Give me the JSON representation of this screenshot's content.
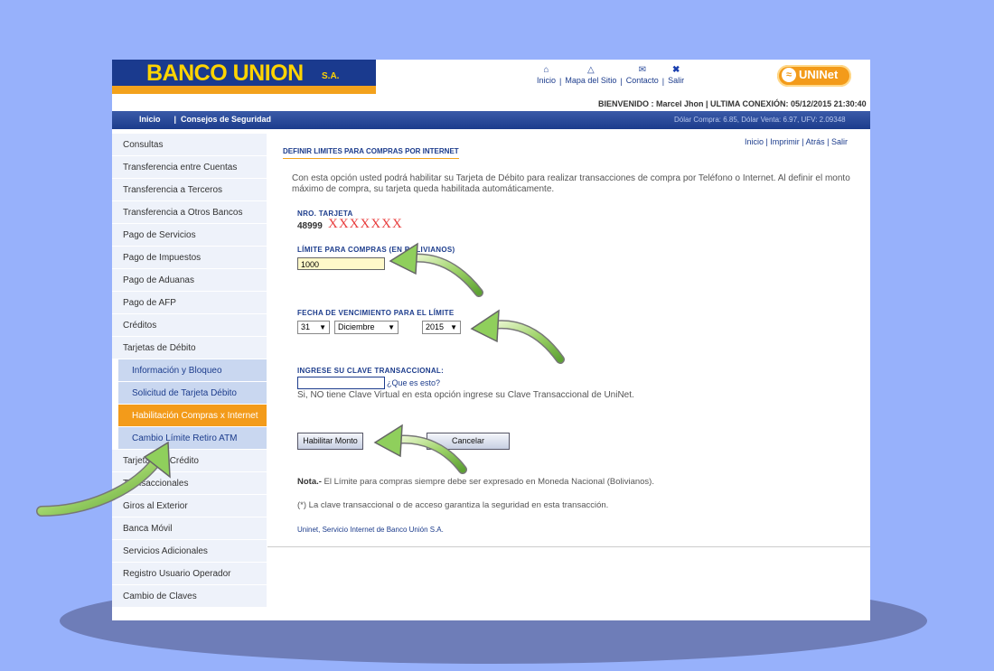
{
  "header": {
    "logo_text": "BANCO UNION",
    "logo_suffix": "S.A.",
    "nav": [
      {
        "label": "Inicio",
        "icon": "home-icon"
      },
      {
        "label": "Mapa del Sitio",
        "icon": "sitemap-icon"
      },
      {
        "label": "Contacto",
        "icon": "mail-icon"
      },
      {
        "label": "Salir",
        "icon": "close-icon"
      }
    ],
    "separator": "|",
    "uninet_logo": "UNINet",
    "welcome": "BIENVENIDO : Marcel Jhon | ULTIMA CONEXIÓN: 05/12/2015 21:30:40"
  },
  "navbar": {
    "links_text": "Inicio      |  Consejos de Seguridad",
    "rates": "Dólar Compra: 6.85, Dólar Venta: 6.97, UFV: 2.09348"
  },
  "sidebar": {
    "items_top": [
      "Consultas",
      "Transferencia entre Cuentas",
      "Transferencia a Terceros",
      "Transferencia a Otros Bancos",
      "Pago de Servicios",
      "Pago de Impuestos",
      "Pago de Aduanas",
      "Pago de AFP",
      "Créditos",
      "Tarjetas de Débito"
    ],
    "sub_items": [
      "Información y Bloqueo",
      "Solicitud de Tarjeta Débito",
      "Habilitación Compras x Internet",
      "Cambio Límite Retiro ATM"
    ],
    "items_bottom": [
      "Tarjetas de Crédito",
      "Transaccionales",
      "Giros al Exterior",
      "Banca Móvil",
      "Servicios Adicionales",
      "Registro Usuario Operador",
      "Cambio de Claves"
    ]
  },
  "content": {
    "util_links": "Inicio | Imprimir | Atrás | Salir",
    "title": "DEFINIR LIMITES PARA COMPRAS POR INTERNET",
    "description": "Con esta opción usted podrá habilitar su Tarjeta de Débito para realizar transacciones de compra por Teléfono o Internet. Al definir el monto máximo de compra, su tarjeta queda habilitada automáticamente.",
    "card_label": "NRO. TARJETA",
    "card_prefix": "48999",
    "card_mask": "XXXXXXX",
    "limit_label": "LÍMITE PARA COMPRAS (EN BOLIVIANOS)",
    "limit_value": "1000",
    "date_label": "FECHA DE VENCIMIENTO PARA EL LÍMITE",
    "day": "31",
    "month": "Diciembre",
    "year": "2015",
    "password_label": "INGRESE SU CLAVE TRANSACCIONAL:",
    "what_is_link": "¿Que es esto?",
    "password_note": "Si, NO tiene Clave Virtual en esta opción ingrese su Clave Transaccional de UniNet.",
    "submit_label": "Habilitar Monto",
    "cancel_label": "Cancelar",
    "note_bold": "Nota.-",
    "note_text": " El Límite para compras siempre debe ser expresado en Moneda Nacional (Bolivianos).",
    "security_note": "(*) La clave transaccional o de acceso garantiza la seguridad en esta transacción.",
    "footer": "Uninet, Servicio Internet de Banco Unión S.A."
  },
  "colors": {
    "background": "#97b1fb",
    "brand_blue": "#1c3c8c",
    "brand_orange": "#f39b1a",
    "logo_yellow": "#ffd400",
    "arrow_green": "#7cc24a"
  }
}
